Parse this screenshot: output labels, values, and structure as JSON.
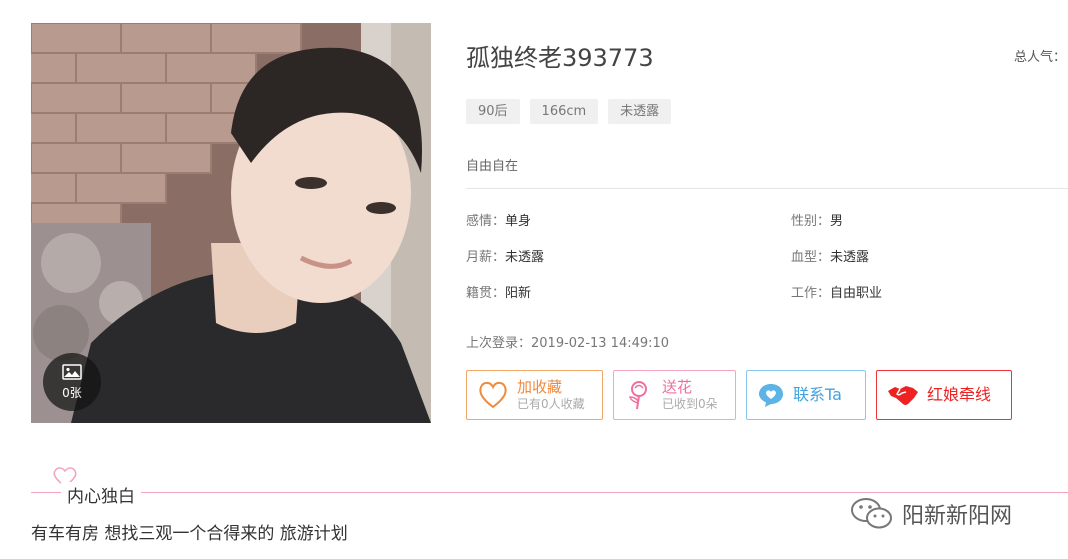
{
  "profile": {
    "name": "孤独终老393773",
    "popularity_label": "总人气：",
    "tags": [
      "90后",
      "166cm",
      "未透露"
    ],
    "motto": "自由自在",
    "photo_count": "0张",
    "info": {
      "emotion": {
        "key": "感情：",
        "value": "单身"
      },
      "gender": {
        "key": "性别：",
        "value": "男"
      },
      "salary": {
        "key": "月薪：",
        "value": "未透露"
      },
      "blood": {
        "key": "血型：",
        "value": "未透露"
      },
      "hometown": {
        "key": "籍贯：",
        "value": "阳新"
      },
      "job": {
        "key": "工作：",
        "value": "自由职业"
      }
    },
    "last_login": "上次登录：2019-02-13 14:49:10"
  },
  "actions": {
    "favorite": {
      "label": "加收藏",
      "sub": "已有0人收藏"
    },
    "flower": {
      "label": "送花",
      "sub": "已收到0朵"
    },
    "contact": {
      "label": "联系Ta"
    },
    "matchmaker": {
      "label": "红娘牵线"
    }
  },
  "section": {
    "title": "内心独白",
    "bio": "有车有房 想找三观一个合得来的 旅游计划"
  },
  "watermark": "阳新新阳网",
  "colors": {
    "favorite": "#f08a3c",
    "flower": "#ef6f9f",
    "contact": "#42a3dd",
    "matchmaker": "#e22222",
    "section_line": "#f2a3bf"
  }
}
